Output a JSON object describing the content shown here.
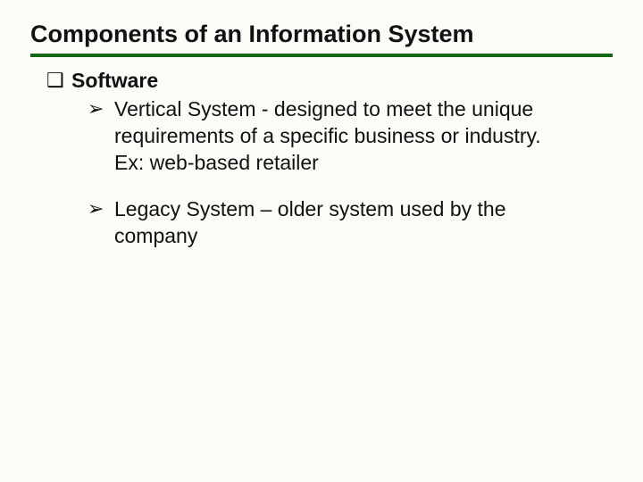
{
  "title": "Components of an Information System",
  "bullets": {
    "square": "❑",
    "arrow": "➢"
  },
  "section": "Software",
  "items": [
    "Vertical System - designed to meet the unique requirements of a specific business or industry. Ex: web-based retailer",
    "Legacy System – older system used by the company"
  ]
}
